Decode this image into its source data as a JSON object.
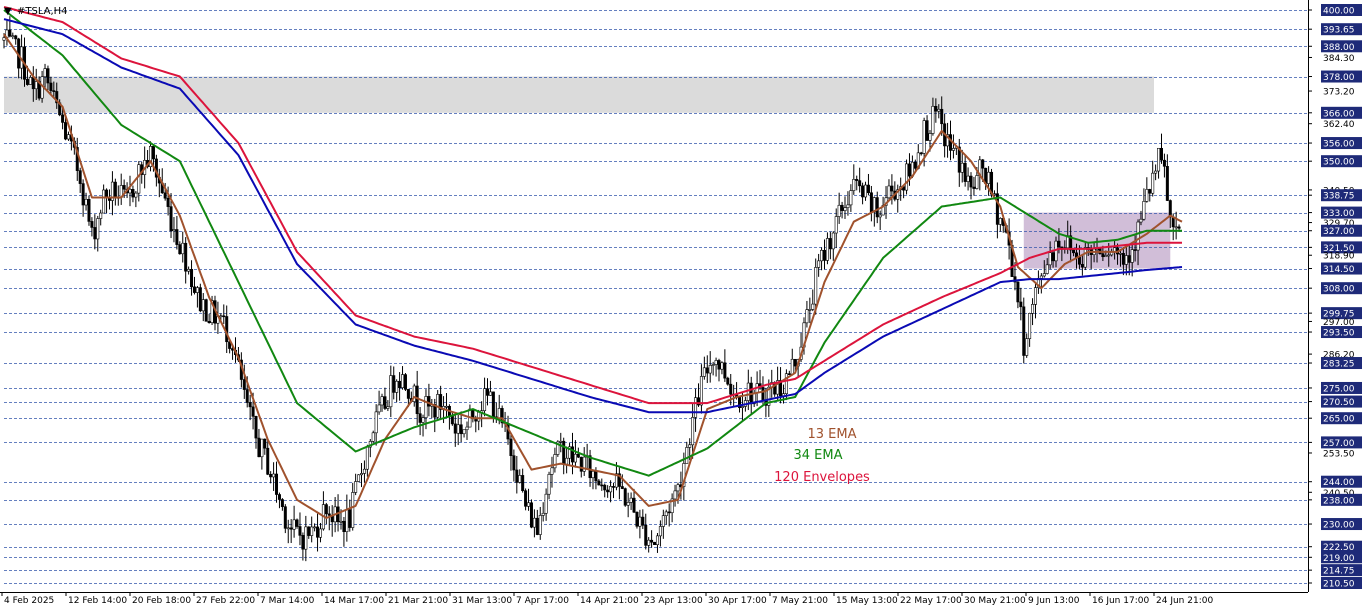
{
  "symbol_label": "#TSLA,H4",
  "annotations": {
    "ema13": "13 EMA",
    "ema34": "34 EMA",
    "envelopes": "120 Envelopes"
  },
  "colors": {
    "background": "#ffffff",
    "candle": "#000000",
    "ema13": "#a0522d",
    "ema34": "#118811",
    "envelope_upper": "#dc143c",
    "envelope_lower": "#0a0ab4",
    "level_line": "#3355aa",
    "resistance_zone": "#d9d9d9",
    "consolidation_zone": "#c9b3d1",
    "price_box_bg": "#1e2a78",
    "price_box_text": "#ffffff"
  },
  "chart_data": {
    "type": "candlestick",
    "symbol": "#TSLA",
    "timeframe": "H4",
    "ylim": [
      207,
      402
    ],
    "y_tick_labels": [
      "400.00",
      "393.65",
      "388.00",
      "384.30",
      "378.00",
      "373.20",
      "366.00",
      "362.40",
      "356.00",
      "350.00",
      "340.50",
      "338.75",
      "333.00",
      "329.70",
      "327.00",
      "321.50",
      "318.90",
      "314.50",
      "308.00",
      "299.75",
      "297.00",
      "293.50",
      "286.20",
      "283.25",
      "275.00",
      "270.50",
      "265.00",
      "257.00",
      "253.50",
      "244.00",
      "240.50",
      "238.00",
      "230.00",
      "222.50",
      "219.00",
      "214.75",
      "210.50"
    ],
    "highlighted_levels": [
      400.0,
      393.65,
      388.0,
      378.0,
      366.0,
      356.0,
      350.0,
      338.75,
      333.0,
      327.0,
      321.5,
      314.5,
      308.0,
      299.75,
      293.5,
      283.25,
      275.0,
      270.5,
      265.0,
      257.0,
      244.0,
      238.0,
      230.0,
      222.5,
      219.0,
      214.75,
      210.5
    ],
    "x_tick_labels": [
      "4 Feb 2025",
      "12 Feb 14:00",
      "20 Feb 18:00",
      "27 Feb 22:00",
      "7 Mar 14:00",
      "14 Mar 17:00",
      "21 Mar 21:00",
      "31 Mar 13:00",
      "7 Apr 17:00",
      "14 Apr 21:00",
      "23 Apr 13:00",
      "30 Apr 17:00",
      "7 May 21:00",
      "15 May 13:00",
      "22 May 17:00",
      "30 May 21:00",
      "9 Jun 13:00",
      "16 Jun 17:00",
      "24 Jun 21:00"
    ],
    "zones": [
      {
        "kind": "resistance",
        "from_date": "4 Feb 2025",
        "to_date": "24 Jun 21:00",
        "price_low": 366.0,
        "price_high": 378.0
      },
      {
        "kind": "consolidation",
        "from_date": "9 Jun 13:00",
        "to_date": "24 Jun 21:00",
        "price_low": 314.5,
        "price_high": 333.0
      }
    ],
    "close_path": [
      [
        0,
        390
      ],
      [
        6,
        384
      ],
      [
        10,
        372
      ],
      [
        14,
        378
      ],
      [
        20,
        362
      ],
      [
        26,
        345
      ],
      [
        30,
        325
      ],
      [
        34,
        338
      ],
      [
        38,
        340
      ],
      [
        42,
        336
      ],
      [
        46,
        346
      ],
      [
        50,
        352
      ],
      [
        54,
        340
      ],
      [
        58,
        328
      ],
      [
        62,
        318
      ],
      [
        66,
        305
      ],
      [
        70,
        300
      ],
      [
        74,
        298
      ],
      [
        78,
        290
      ],
      [
        82,
        272
      ],
      [
        86,
        258
      ],
      [
        90,
        250
      ],
      [
        94,
        238
      ],
      [
        98,
        228
      ],
      [
        102,
        226
      ],
      [
        106,
        228
      ],
      [
        110,
        236
      ],
      [
        114,
        230
      ],
      [
        118,
        232
      ],
      [
        122,
        248
      ],
      [
        126,
        262
      ],
      [
        130,
        270
      ],
      [
        134,
        280
      ],
      [
        138,
        276
      ],
      [
        142,
        268
      ],
      [
        146,
        268
      ],
      [
        150,
        270
      ],
      [
        154,
        262
      ],
      [
        158,
        262
      ],
      [
        162,
        270
      ],
      [
        166,
        272
      ],
      [
        170,
        262
      ],
      [
        174,
        252
      ],
      [
        178,
        236
      ],
      [
        182,
        228
      ],
      [
        186,
        248
      ],
      [
        190,
        255
      ],
      [
        194,
        252
      ],
      [
        198,
        250
      ],
      [
        202,
        245
      ],
      [
        206,
        244
      ],
      [
        210,
        242
      ],
      [
        214,
        236
      ],
      [
        218,
        228
      ],
      [
        222,
        224
      ],
      [
        226,
        234
      ],
      [
        230,
        242
      ],
      [
        234,
        260
      ],
      [
        238,
        276
      ],
      [
        242,
        286
      ],
      [
        246,
        280
      ],
      [
        250,
        272
      ],
      [
        254,
        274
      ],
      [
        258,
        272
      ],
      [
        262,
        275
      ],
      [
        266,
        276
      ],
      [
        270,
        284
      ],
      [
        274,
        298
      ],
      [
        278,
        315
      ],
      [
        282,
        325
      ],
      [
        286,
        334
      ],
      [
        290,
        342
      ],
      [
        294,
        338
      ],
      [
        298,
        332
      ],
      [
        302,
        340
      ],
      [
        306,
        342
      ],
      [
        310,
        348
      ],
      [
        314,
        360
      ],
      [
        318,
        365
      ],
      [
        322,
        356
      ],
      [
        326,
        350
      ],
      [
        330,
        340
      ],
      [
        334,
        348
      ],
      [
        338,
        336
      ],
      [
        342,
        326
      ],
      [
        346,
        305
      ],
      [
        348,
        290
      ],
      [
        352,
        306
      ],
      [
        356,
        318
      ],
      [
        360,
        324
      ],
      [
        364,
        322
      ],
      [
        366,
        318
      ],
      [
        370,
        320
      ],
      [
        374,
        322
      ],
      [
        378,
        322
      ],
      [
        382,
        318
      ],
      [
        386,
        324
      ],
      [
        390,
        338
      ],
      [
        394,
        350
      ],
      [
        396,
        346
      ],
      [
        398,
        330
      ],
      [
        400,
        324
      ],
      [
        402,
        326
      ]
    ],
    "series": [
      {
        "name": "13 EMA",
        "values": [
          [
            0,
            392
          ],
          [
            10,
            378
          ],
          [
            20,
            368
          ],
          [
            30,
            338
          ],
          [
            40,
            338
          ],
          [
            50,
            350
          ],
          [
            60,
            332
          ],
          [
            70,
            305
          ],
          [
            80,
            285
          ],
          [
            90,
            258
          ],
          [
            100,
            238
          ],
          [
            110,
            232
          ],
          [
            120,
            236
          ],
          [
            130,
            258
          ],
          [
            140,
            272
          ],
          [
            150,
            268
          ],
          [
            160,
            265
          ],
          [
            170,
            265
          ],
          [
            180,
            248
          ],
          [
            190,
            250
          ],
          [
            200,
            248
          ],
          [
            210,
            246
          ],
          [
            220,
            236
          ],
          [
            230,
            238
          ],
          [
            240,
            268
          ],
          [
            250,
            272
          ],
          [
            260,
            274
          ],
          [
            270,
            280
          ],
          [
            280,
            310
          ],
          [
            290,
            330
          ],
          [
            300,
            335
          ],
          [
            310,
            345
          ],
          [
            320,
            360
          ],
          [
            330,
            350
          ],
          [
            340,
            335
          ],
          [
            346,
            315
          ],
          [
            354,
            308
          ],
          [
            362,
            316
          ],
          [
            370,
            320
          ],
          [
            380,
            320
          ],
          [
            390,
            326
          ],
          [
            398,
            332
          ],
          [
            402,
            330
          ]
        ]
      },
      {
        "name": "34 EMA",
        "values": [
          [
            0,
            400
          ],
          [
            20,
            385
          ],
          [
            40,
            362
          ],
          [
            60,
            350
          ],
          [
            80,
            310
          ],
          [
            100,
            270
          ],
          [
            120,
            254
          ],
          [
            140,
            262
          ],
          [
            160,
            268
          ],
          [
            180,
            260
          ],
          [
            200,
            252
          ],
          [
            220,
            246
          ],
          [
            240,
            255
          ],
          [
            260,
            270
          ],
          [
            270,
            272
          ],
          [
            280,
            290
          ],
          [
            300,
            318
          ],
          [
            320,
            335
          ],
          [
            340,
            338
          ],
          [
            350,
            332
          ],
          [
            360,
            326
          ],
          [
            370,
            323
          ],
          [
            380,
            324
          ],
          [
            390,
            327
          ],
          [
            402,
            327
          ]
        ]
      },
      {
        "name": "envelope upper",
        "values": [
          [
            0,
            401
          ],
          [
            20,
            396
          ],
          [
            40,
            384
          ],
          [
            60,
            378
          ],
          [
            80,
            356
          ],
          [
            100,
            320
          ],
          [
            120,
            299
          ],
          [
            140,
            292
          ],
          [
            160,
            288
          ],
          [
            180,
            282
          ],
          [
            200,
            276
          ],
          [
            220,
            270
          ],
          [
            240,
            270
          ],
          [
            260,
            276
          ],
          [
            270,
            278
          ],
          [
            280,
            284
          ],
          [
            300,
            296
          ],
          [
            320,
            305
          ],
          [
            340,
            313
          ],
          [
            350,
            318
          ],
          [
            360,
            321
          ],
          [
            370,
            321
          ],
          [
            380,
            322
          ],
          [
            390,
            323
          ],
          [
            402,
            323
          ]
        ]
      },
      {
        "name": "envelope lower",
        "values": [
          [
            0,
            397
          ],
          [
            20,
            392
          ],
          [
            40,
            381
          ],
          [
            60,
            374
          ],
          [
            80,
            352
          ],
          [
            100,
            316
          ],
          [
            120,
            296
          ],
          [
            140,
            289
          ],
          [
            160,
            284
          ],
          [
            180,
            278
          ],
          [
            200,
            272
          ],
          [
            220,
            267
          ],
          [
            240,
            267
          ],
          [
            260,
            271
          ],
          [
            270,
            273
          ],
          [
            280,
            280
          ],
          [
            300,
            292
          ],
          [
            320,
            301
          ],
          [
            340,
            310
          ],
          [
            350,
            311
          ],
          [
            360,
            311
          ],
          [
            370,
            312
          ],
          [
            380,
            313
          ],
          [
            390,
            314
          ],
          [
            402,
            315
          ]
        ]
      }
    ],
    "current_price": 327.0
  }
}
